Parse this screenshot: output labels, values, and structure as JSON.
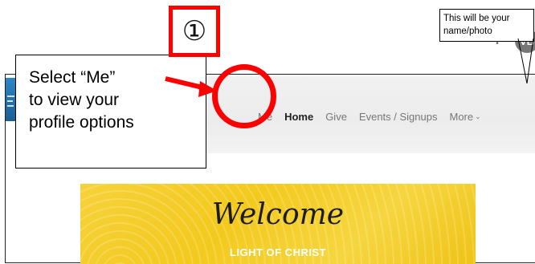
{
  "navbar": {
    "items": [
      {
        "label": "Me"
      },
      {
        "label": "Home"
      },
      {
        "label": "Give"
      },
      {
        "label": "Events / Signups"
      },
      {
        "label": "More"
      }
    ],
    "avatar_initials": "VB",
    "bell_icon": "bell-icon"
  },
  "banner": {
    "welcome": "Welcome",
    "church": "LIGHT OF CHRIST"
  },
  "annotations": {
    "step_number": "①",
    "callout_line1": "Select “Me”",
    "callout_line2": "to view your",
    "callout_line3": "profile options",
    "note_line1": "This will be your",
    "note_line2": "name/photo"
  },
  "colors": {
    "annotation_red": "#ff0000",
    "banner_yellow": "#f3c91c",
    "avatar_gray": "#777777"
  }
}
